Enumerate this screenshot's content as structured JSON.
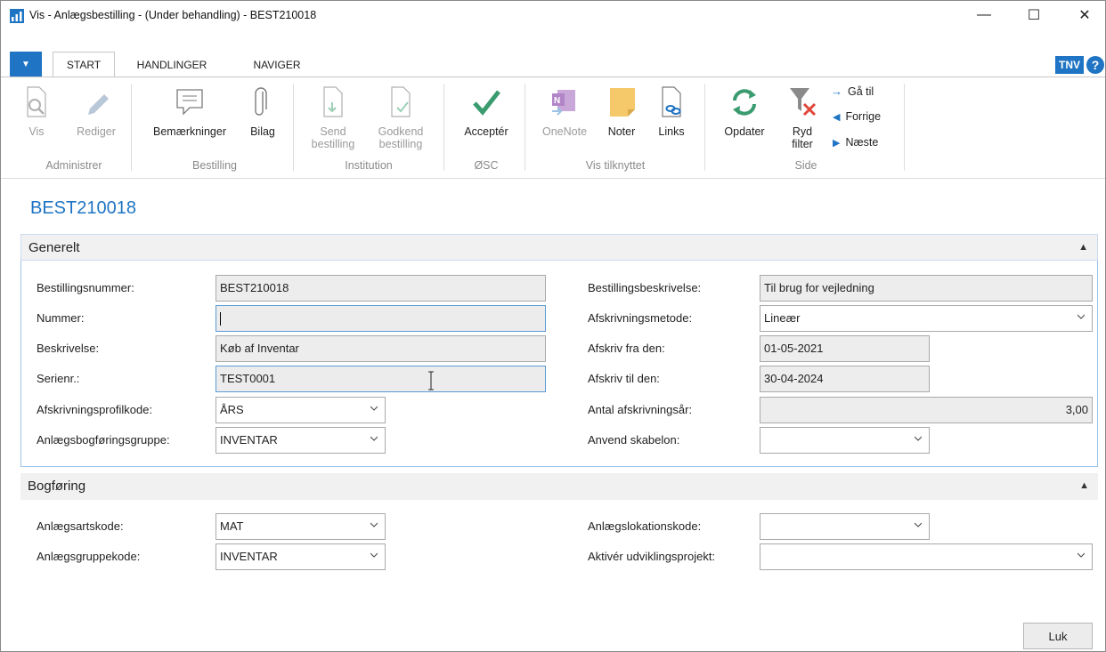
{
  "window": {
    "title": "Vis - Anlægsbestilling - (Under behandling) - BEST210018",
    "minimize": "—",
    "maximize": "☐",
    "close": "✕"
  },
  "tabs": [
    {
      "label": "START",
      "active": true
    },
    {
      "label": "HANDLINGER",
      "active": false
    },
    {
      "label": "NAVIGER",
      "active": false
    }
  ],
  "user_badge": "TNV",
  "help_label": "?",
  "ribbon": {
    "groups": [
      {
        "label": "Administrer",
        "buttons": [
          {
            "label": "Vis",
            "icon": "view-icon",
            "disabled": true
          },
          {
            "label": "Rediger",
            "icon": "edit-icon",
            "disabled": true
          }
        ]
      },
      {
        "label": "Bestilling",
        "buttons": [
          {
            "label": "Bemærkninger",
            "icon": "comment-icon"
          },
          {
            "label": "Bilag",
            "icon": "paperclip-icon"
          }
        ]
      },
      {
        "label": "Institution",
        "buttons": [
          {
            "label1": "Send",
            "label2": "bestilling",
            "icon": "send-document-icon",
            "disabled": true
          },
          {
            "label1": "Godkend",
            "label2": "bestilling",
            "icon": "approve-document-icon",
            "disabled": true
          }
        ]
      },
      {
        "label": "ØSC",
        "buttons": [
          {
            "label": "Acceptér",
            "icon": "checkmark-icon"
          }
        ]
      },
      {
        "label": "Vis tilknyttet",
        "buttons": [
          {
            "label": "OneNote",
            "icon": "onenote-icon",
            "disabled": true
          },
          {
            "label": "Noter",
            "icon": "note-icon"
          },
          {
            "label": "Links",
            "icon": "link-document-icon"
          }
        ]
      },
      {
        "label": "Side",
        "buttons": [
          {
            "label": "Opdater",
            "icon": "refresh-icon"
          },
          {
            "label1": "Ryd",
            "label2": "filter",
            "icon": "clear-filter-icon"
          }
        ]
      }
    ],
    "nav": {
      "goto": "Gå til",
      "previous": "Forrige",
      "next": "Næste"
    }
  },
  "page_title": "BEST210018",
  "generelt": {
    "title": "Generelt",
    "left": [
      {
        "label": "Bestillingsnummer:",
        "value": "BEST210018"
      },
      {
        "label": "Nummer:",
        "value": ""
      },
      {
        "label": "Beskrivelse:",
        "value": "Køb af Inventar"
      },
      {
        "label": "Serienr.:",
        "value": "TEST0001"
      },
      {
        "label": "Afskrivningsprofilkode:",
        "value": "ÅRS"
      },
      {
        "label": "Anlægsbogføringsgruppe:",
        "value": "INVENTAR"
      }
    ],
    "right": [
      {
        "label": "Bestillingsbeskrivelse:",
        "value": "Til brug for vejledning"
      },
      {
        "label": "Afskrivningsmetode:",
        "value": "Lineær"
      },
      {
        "label": "Afskriv fra den:",
        "value": "01-05-2021"
      },
      {
        "label": "Afskriv til den:",
        "value": "30-04-2024"
      },
      {
        "label": "Antal afskrivningsår:",
        "value": "3,00"
      },
      {
        "label": "Anvend skabelon:",
        "value": ""
      }
    ]
  },
  "bogforing": {
    "title": "Bogføring",
    "left": [
      {
        "label": "Anlægsartskode:",
        "value": "MAT"
      },
      {
        "label": "Anlægsgruppekode:",
        "value": "INVENTAR"
      }
    ],
    "right": [
      {
        "label": "Anlægslokationskode:",
        "value": ""
      },
      {
        "label": "Aktivér udviklingsprojekt:",
        "value": ""
      }
    ]
  },
  "close_button": "Luk",
  "colors": {
    "accent": "#1f74c4",
    "accept_green": "#3a9b6f",
    "cancel_red": "#e0463a"
  }
}
